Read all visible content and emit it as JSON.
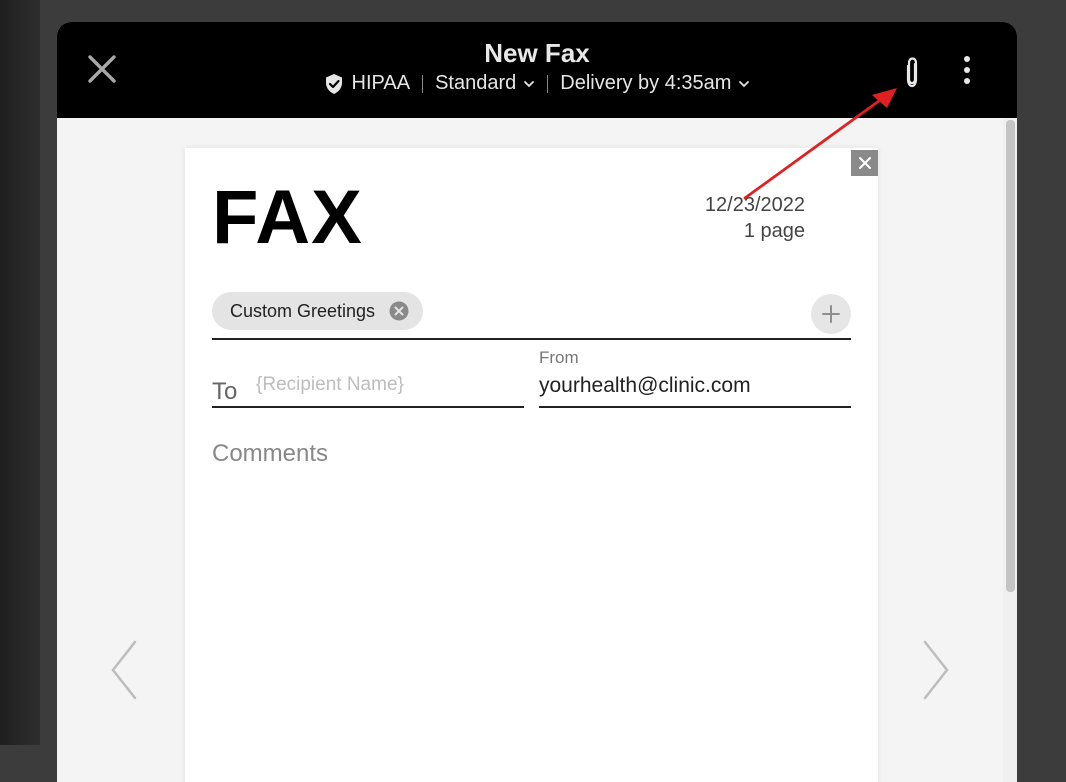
{
  "header": {
    "title": "New Fax",
    "hipaa_label": "HIPAA",
    "quality_label": "Standard",
    "delivery_label": "Delivery by 4:35am"
  },
  "cover_page": {
    "heading": "FAX",
    "date": "12/23/2022",
    "page_count": "1 page",
    "greeting_chip": "Custom Greetings",
    "to_label": "To",
    "to_value": "",
    "to_placeholder": "{Recipient Name}",
    "from_label": "From",
    "from_value": "yourhealth@clinic.com",
    "comments_placeholder": "Comments"
  },
  "icons": {
    "close": "close-icon",
    "shield": "shield-check-icon",
    "chevron": "chevron-down-icon",
    "attach": "paperclip-icon",
    "more": "more-vertical-icon",
    "prev": "chevron-left-icon",
    "next": "chevron-right-icon"
  },
  "colors": {
    "header_bg": "#000000",
    "annotation_arrow": "#e02020"
  }
}
